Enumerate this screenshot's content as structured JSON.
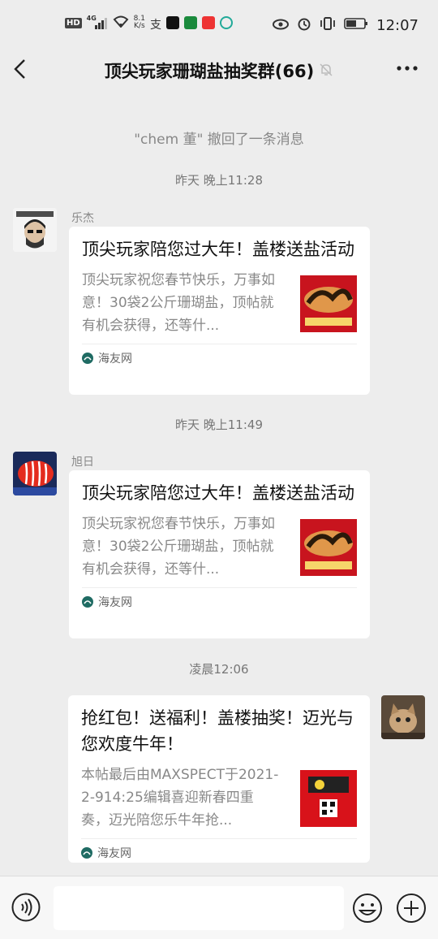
{
  "status": {
    "net_rate_value": "8.1",
    "net_rate_unit": "K/s",
    "time": "12:07",
    "hd_label": "HD",
    "network": "4G"
  },
  "header": {
    "back_icon": "chevron-left-icon",
    "title": "顶尖玩家珊瑚盐抽奖群(66)",
    "mute_icon": "bell-off-icon",
    "more_icon": "more-dots-icon"
  },
  "system_message": "\"chem 董\" 撤回了一条消息",
  "messages": [
    {
      "time": "昨天 晚上11:28",
      "sender": "乐杰",
      "card": {
        "title": "顶尖玩家陪您过大年！盖楼送盐活动",
        "desc": "顶尖玩家祝您春节快乐，万事如意！30袋2公斤珊瑚盐，顶帖就有机会获得，还等什...",
        "source": "海友网"
      }
    },
    {
      "time": "昨天 晚上11:49",
      "sender": "旭日",
      "card": {
        "title": "顶尖玩家陪您过大年！盖楼送盐活动",
        "desc": "顶尖玩家祝您春节快乐，万事如意！30袋2公斤珊瑚盐，顶帖就有机会获得，还等什...",
        "source": "海友网"
      }
    },
    {
      "time": "凌晨12:06",
      "sender": "",
      "card": {
        "title": "抢红包！送福利！盖楼抽奖！迈光与您欢度牛年！",
        "desc": "本帖最后由MAXSPECT于2021-2-914:25编辑喜迎新春四重奏，迈光陪您乐牛年抢...",
        "source": "海友网"
      }
    }
  ],
  "input": {
    "voice_icon": "voice-icon",
    "emoji_icon": "emoji-icon",
    "plus_icon": "plus-icon",
    "placeholder": ""
  }
}
